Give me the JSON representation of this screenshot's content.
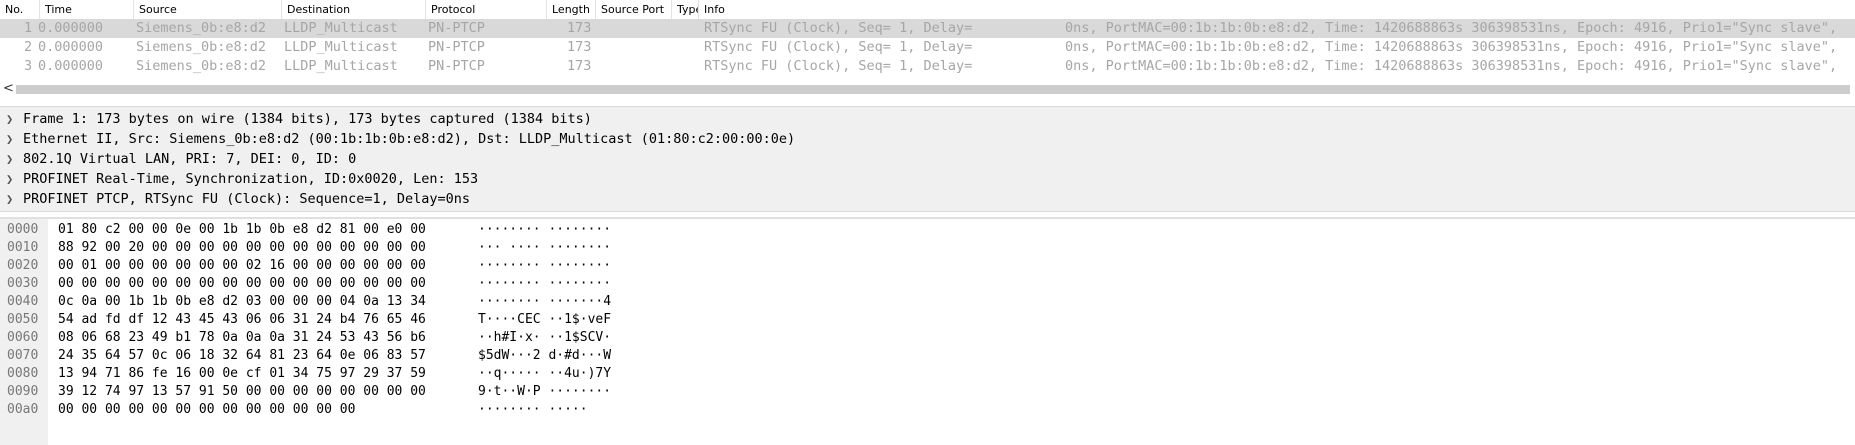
{
  "packet_list": {
    "columns": [
      "No.",
      "Time",
      "Source",
      "Destination",
      "Protocol",
      "Length",
      "Source Port",
      "Type",
      "Info"
    ],
    "rows": [
      {
        "no": "1",
        "time": "0.000000",
        "source": "Siemens_0b:e8:d2",
        "destination": "LLDP_Multicast",
        "protocol": "PN-PTCP",
        "length": "173",
        "info_a": "RTSync FU (Clock), Seq=  1, Delay=",
        "info_b": "0ns, PortMAC=00:1b:1b:0b:e8:d2, Time: 1420688863s 306398531ns, Epoch: 4916, Prio1=\"Sync slave\","
      },
      {
        "no": "2",
        "time": "0.000000",
        "source": "Siemens_0b:e8:d2",
        "destination": "LLDP_Multicast",
        "protocol": "PN-PTCP",
        "length": "173",
        "info_a": "RTSync FU (Clock), Seq=  1, Delay=",
        "info_b": "0ns, PortMAC=00:1b:1b:0b:e8:d2, Time: 1420688863s 306398531ns, Epoch: 4916, Prio1=\"Sync slave\","
      },
      {
        "no": "3",
        "time": "0.000000",
        "source": "Siemens_0b:e8:d2",
        "destination": "LLDP_Multicast",
        "protocol": "PN-PTCP",
        "length": "173",
        "info_a": "RTSync FU (Clock), Seq=  1, Delay=",
        "info_b": "0ns, PortMAC=00:1b:1b:0b:e8:d2, Time: 1420688863s 306398531ns, Epoch: 4916, Prio1=\"Sync slave\","
      }
    ],
    "scroll_left_arrow": "<"
  },
  "details": [
    "Frame 1: 173 bytes on wire (1384 bits), 173 bytes captured (1384 bits)",
    "Ethernet II, Src: Siemens_0b:e8:d2 (00:1b:1b:0b:e8:d2), Dst: LLDP_Multicast (01:80:c2:00:00:0e)",
    "802.1Q Virtual LAN, PRI: 7, DEI: 0, ID: 0",
    "PROFINET Real-Time, Synchronization, ID:0x0020, Len: 153",
    "PROFINET PTCP, RTSync FU (Clock): Sequence=1, Delay=0ns"
  ],
  "bytes": [
    {
      "offset": "0000",
      "hex": "01 80 c2 00 00 0e 00 1b  1b 0b e8 d2 81 00 e0 00",
      "ascii": "········ ········"
    },
    {
      "offset": "0010",
      "hex": "88 92 00 20 00 00 00 00  00 00 00 00 00 00 00 00",
      "ascii": "··· ···· ········"
    },
    {
      "offset": "0020",
      "hex": "00 01 00 00 00 00 00 00  02 16 00 00 00 00 00 00",
      "ascii": "········ ········"
    },
    {
      "offset": "0030",
      "hex": "00 00 00 00 00 00 00 00  00 00 00 00 00 00 00 00",
      "ascii": "········ ········"
    },
    {
      "offset": "0040",
      "hex": "0c 0a 00 1b 1b 0b e8 d2  03 00 00 00 04 0a 13 34",
      "ascii": "········ ·······4"
    },
    {
      "offset": "0050",
      "hex": "54 ad fd df 12 43 45 43  06 06 31 24 b4 76 65 46",
      "ascii": "T····CEC ··1$·veF"
    },
    {
      "offset": "0060",
      "hex": "08 06 68 23 49 b1 78 0a  0a 0a 31 24 53 43 56 b6",
      "ascii": "··h#I·x· ··1$SCV·"
    },
    {
      "offset": "0070",
      "hex": "24 35 64 57 0c 06 18 32  64 81 23 64 0e 06 83 57",
      "ascii": "$5dW···2 d·#d···W"
    },
    {
      "offset": "0080",
      "hex": "13 94 71 86 fe 16 00 0e  cf 01 34 75 97 29 37 59",
      "ascii": "··q····· ··4u·)7Y"
    },
    {
      "offset": "0090",
      "hex": "39 12 74 97 13 57 91 50  00 00 00 00 00 00 00 00",
      "ascii": "9·t··W·P ········"
    },
    {
      "offset": "00a0",
      "hex": "00 00 00 00 00 00 00 00  00 00 00 00 00",
      "ascii": "········ ·····"
    }
  ],
  "icons": {
    "expand": "chevron-right-icon"
  },
  "colors": {
    "selected_row": "#d9d9d9",
    "dimmed_text": "#a6a6a6",
    "pane_bg": "#f0f0f0"
  }
}
